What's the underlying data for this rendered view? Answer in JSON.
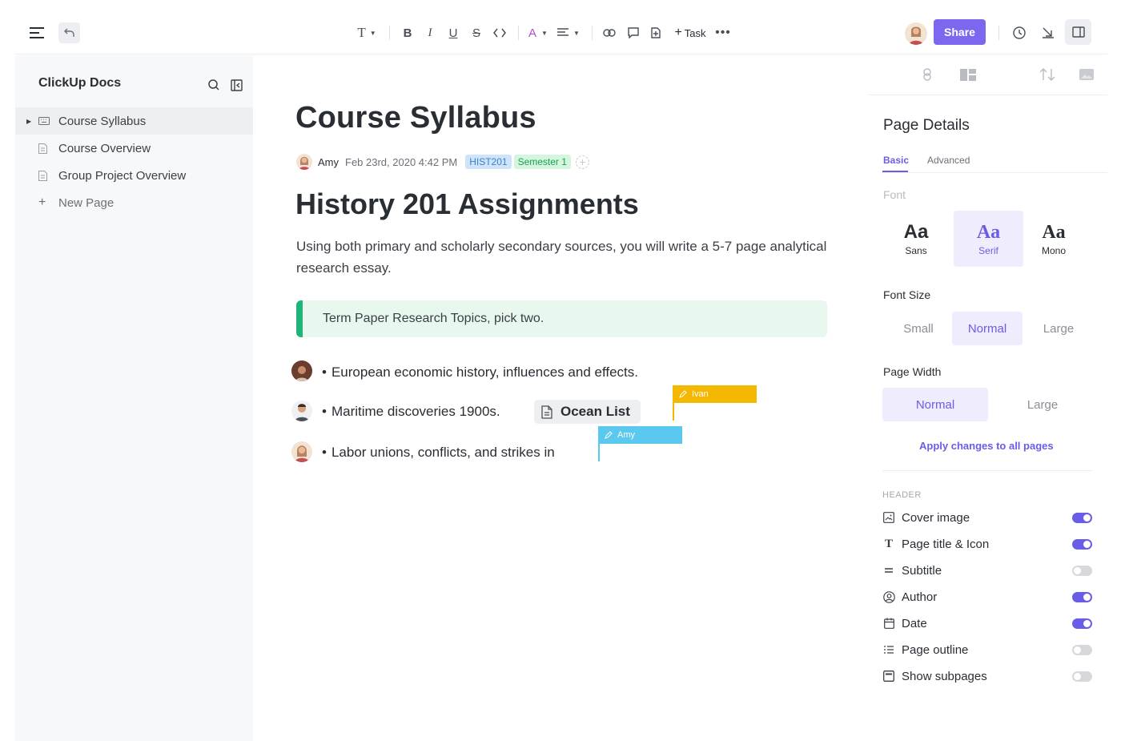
{
  "toolbar": {
    "share_label": "Share",
    "task_label": "Task",
    "text_style_glyph": "T",
    "bold_glyph": "B",
    "italic_glyph": "I",
    "underline_glyph": "U",
    "strike_glyph": "S",
    "color_glyph": "A",
    "accent": "#7b68ee"
  },
  "sidebar": {
    "title": "ClickUp Docs",
    "items": [
      {
        "label": "Course Syllabus",
        "icon": "keyboard-icon",
        "active": true
      },
      {
        "label": "Course Overview",
        "icon": "page-icon"
      },
      {
        "label": "Group Project Overview",
        "icon": "page-icon"
      },
      {
        "label": "New Page",
        "icon": "plus-icon"
      }
    ]
  },
  "doc": {
    "title": "Course Syllabus",
    "author": "Amy",
    "date": "Feb 23rd, 2020 4:42 PM",
    "tags": [
      {
        "label": "HIST201",
        "bg": "#cfe3fb",
        "fg": "#3b82c4"
      },
      {
        "label": "Semester 1",
        "bg": "#d4f5de",
        "fg": "#1f9d55"
      }
    ],
    "heading": "History 201 Assignments",
    "paragraph": "Using both primary and scholarly secondary sources, you will write a 5-7 page analytical research essay.",
    "callout": "Term Paper Research Topics, pick two.",
    "bullets": [
      "European economic history, influences and effects.",
      "Maritime discoveries 1900s.",
      "Labor unions, conflicts, and strikes in"
    ],
    "chip": "Ocean List",
    "cursors": [
      {
        "name": "Ivan",
        "color": "#f5b800"
      },
      {
        "name": "Amy",
        "color": "#5bc8ef"
      }
    ]
  },
  "panel": {
    "title": "Page Details",
    "tabs": [
      "Basic",
      "Advanced"
    ],
    "font_label": "Font",
    "fonts": [
      {
        "sample": "Aa",
        "name": "Sans"
      },
      {
        "sample": "Aa",
        "name": "Serif",
        "selected": true
      },
      {
        "sample": "Aa",
        "name": "Mono"
      }
    ],
    "font_size_label": "Font Size",
    "font_sizes": [
      "Small",
      "Normal",
      "Large"
    ],
    "font_size_selected": "Normal",
    "page_width_label": "Page Width",
    "page_widths": [
      "Normal",
      "Large"
    ],
    "page_width_selected": "Normal",
    "apply_label": "Apply changes to all pages",
    "header_label": "HEADER",
    "toggles": [
      {
        "label": "Cover image",
        "on": true,
        "icon": "image-icon"
      },
      {
        "label": "Page title & Icon",
        "on": true,
        "icon": "text-icon"
      },
      {
        "label": "Subtitle",
        "on": false,
        "icon": "subtitle-icon"
      },
      {
        "label": "Author",
        "on": true,
        "icon": "user-circle-icon"
      },
      {
        "label": "Date",
        "on": true,
        "icon": "calendar-icon"
      },
      {
        "label": "Page outline",
        "on": false,
        "icon": "list-icon"
      },
      {
        "label": "Show subpages",
        "on": false,
        "icon": "subpages-icon"
      }
    ]
  }
}
